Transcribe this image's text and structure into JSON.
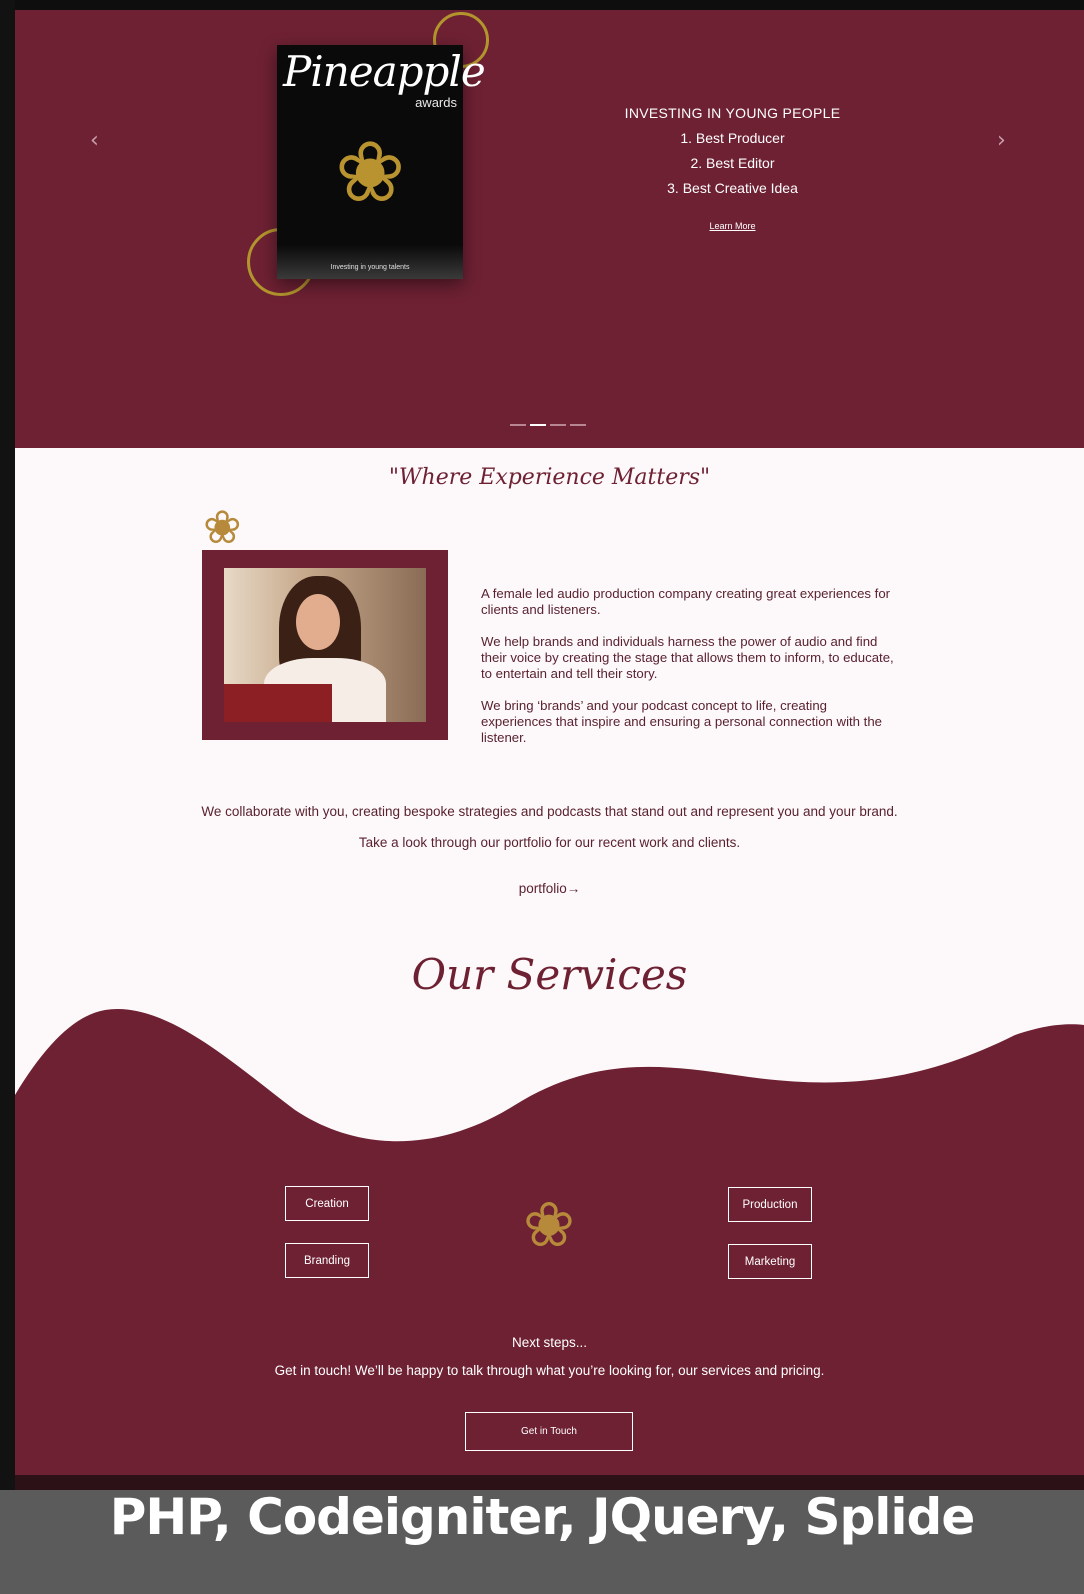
{
  "hero": {
    "poster_title": "Pineapple",
    "poster_subtitle": "awards",
    "poster_tagline": "Investing in young talents",
    "heading": "INVESTING IN YOUNG PEOPLE",
    "items": [
      "1. Best Producer",
      "2. Best Editor",
      "3. Best Creative Idea"
    ],
    "link": "Learn More",
    "prev_icon": "‹",
    "next_icon": "›",
    "slides_total": 4,
    "active_slide": 2
  },
  "about": {
    "tagline": "\"Where Experience Matters\"",
    "paragraphs": [
      "A female led audio production company creating great experiences for clients and listeners.",
      "We help brands and individuals harness the power of audio and find their voice by creating the stage that allows them to inform, to educate, to entertain and tell their story.",
      "We bring ‘brands’ and your podcast concept to life, creating experiences that inspire and ensuring a personal connection with the listener."
    ],
    "collab": "We collaborate with you, creating bespoke strategies and podcasts that stand out and represent you and your brand.",
    "look": "Take a look through our portfolio for our recent work and clients.",
    "portfolio_link": "portfolio→"
  },
  "services": {
    "title": "Our Services",
    "buttons": {
      "creation": "Creation",
      "branding": "Branding",
      "production": "Production",
      "marketing": "Marketing"
    },
    "next_steps": "Next steps...",
    "get_text": "Get in touch! We’ll be happy to talk through what you’re looking for, our services and pricing.",
    "cta": "Get in Touch"
  },
  "caption": "PHP, Codeigniter, JQuery, Splide",
  "colors": {
    "brand": "#6e2133",
    "gold": "#b3952d",
    "background": "#fdf9fa"
  }
}
